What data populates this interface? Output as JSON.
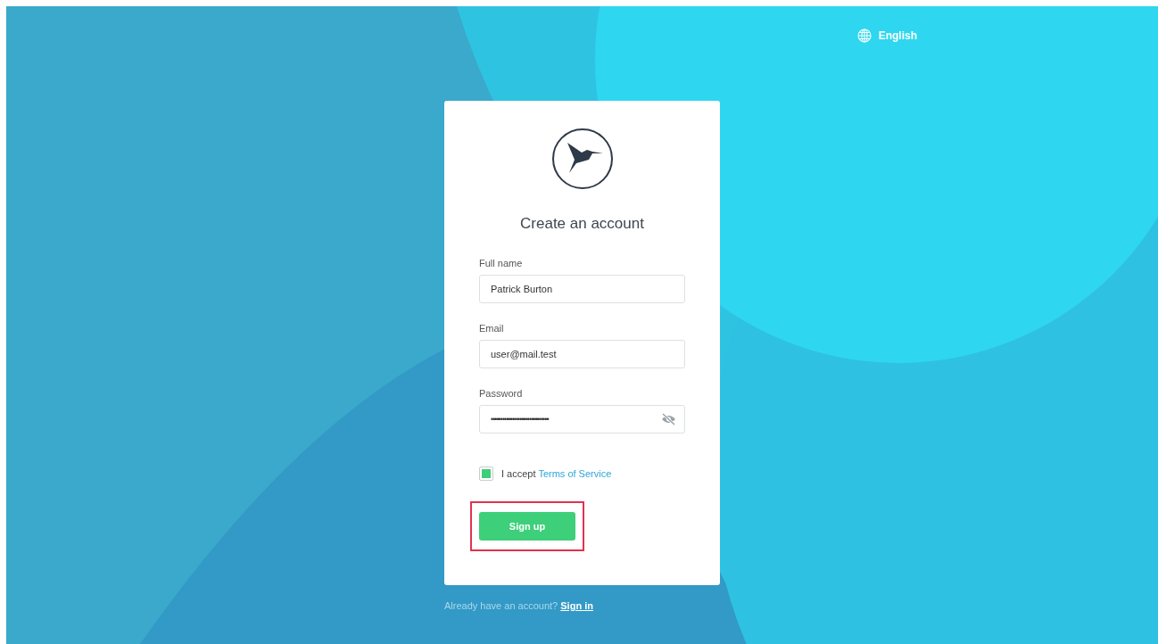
{
  "language": {
    "label": "English"
  },
  "card": {
    "title": "Create an account",
    "fields": [
      {
        "kind": "text",
        "label": "Full name",
        "value": "Patrick Burton"
      },
      {
        "kind": "text",
        "label": "Email",
        "value": "user@mail.test"
      },
      {
        "kind": "password",
        "label": "Password",
        "value": "••••••••••••••••••••••••••••••"
      }
    ],
    "terms": {
      "checked": true,
      "text": "I accept",
      "link": "Terms of Service"
    },
    "submit": {
      "label": "Sign up",
      "highlighted": true
    }
  },
  "footer": {
    "text": "Already have an account?",
    "link": "Sign in"
  }
}
